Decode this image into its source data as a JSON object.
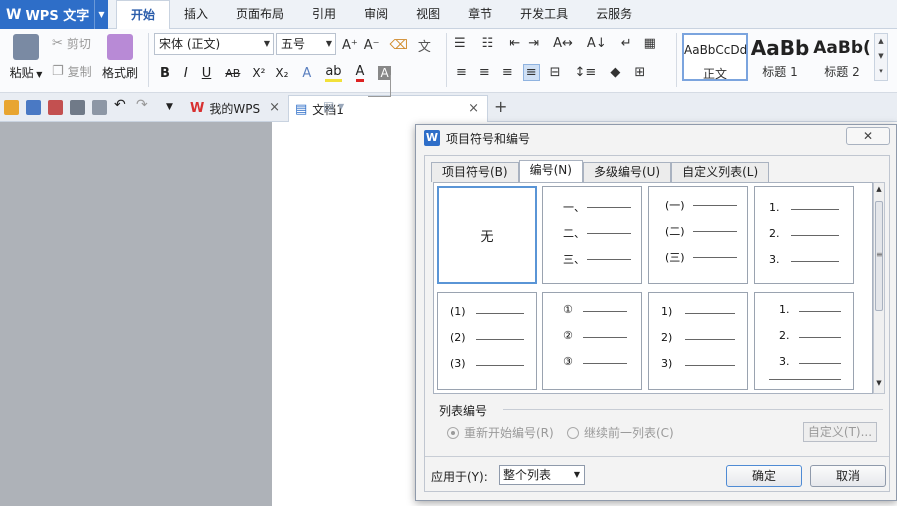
{
  "app": {
    "name": "WPS 文字"
  },
  "menu_tabs": [
    "开始",
    "插入",
    "页面布局",
    "引用",
    "审阅",
    "视图",
    "章节",
    "开发工具",
    "云服务"
  ],
  "ribbon": {
    "paste": "粘贴",
    "cut": "剪切",
    "copy": "复制",
    "format_painter": "格式刷",
    "font_name": "宋体 (正文)",
    "font_size": "五号",
    "styles": [
      {
        "sample": "AaBbCcDd",
        "name": "正文"
      },
      {
        "sample": "AaBb",
        "name": "标题 1"
      },
      {
        "sample": "AaBb(",
        "name": "标题 2"
      }
    ]
  },
  "doc_tabs": [
    {
      "label": "我的WPS",
      "icon": "wps-logo-icon"
    },
    {
      "label": "文档1",
      "icon": "document-icon"
    }
  ],
  "dialog": {
    "title": "项目符号和编号",
    "close_label": "✕",
    "tabs": [
      "项目符号(B)",
      "编号(N)",
      "多级编号(U)",
      "自定义列表(L)"
    ],
    "active_tab": 1,
    "gallery": {
      "none_label": "无",
      "row1": [
        {
          "markers": [
            "一、",
            "二、",
            "三、"
          ]
        },
        {
          "markers": [
            "(一)",
            "(二)",
            "(三)"
          ]
        },
        {
          "markers": [
            "1.",
            "2.",
            "3."
          ]
        }
      ],
      "row2": [
        {
          "markers": [
            "(1)",
            "(2)",
            "(3)"
          ]
        },
        {
          "markers": [
            "①",
            "②",
            "③"
          ]
        },
        {
          "markers": [
            "1)",
            "2)",
            "3)"
          ]
        },
        {
          "markers": [
            "1.",
            "2.",
            "3."
          ]
        }
      ]
    },
    "list_numbering_label": "列表编号",
    "restart_label": "重新开始编号(R)",
    "continue_label": "继续前一列表(C)",
    "custom_label": "自定义(T)...",
    "apply_to_label": "应用于(Y):",
    "apply_to_value": "整个列表",
    "ok_label": "确定",
    "cancel_label": "取消"
  },
  "colors": {
    "accent": "#2e6ec8",
    "selection": "#5a95d6"
  }
}
